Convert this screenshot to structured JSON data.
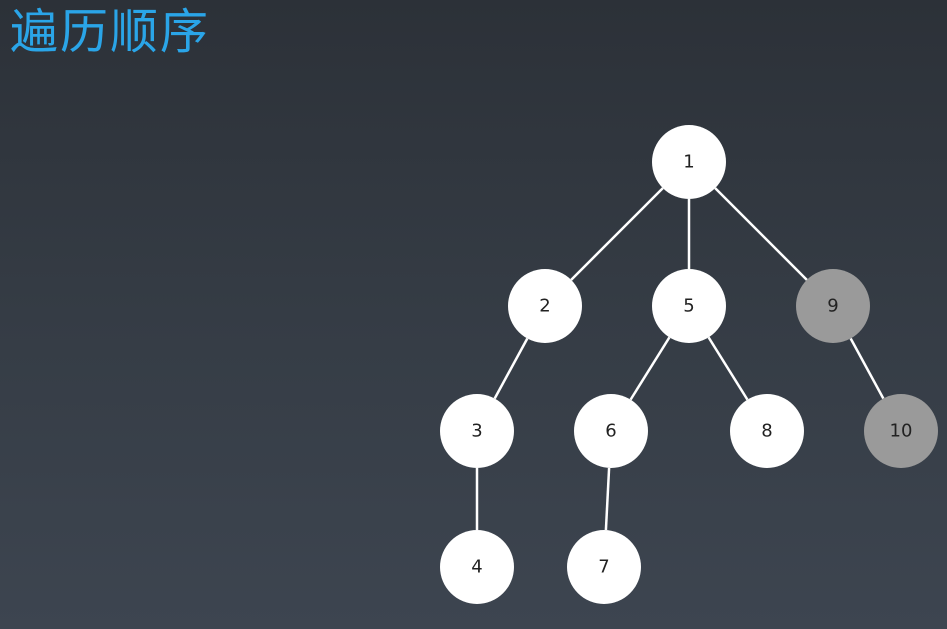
{
  "title": "遍历顺序",
  "colors": {
    "title": "#2aa5e8",
    "node_fill": "#ffffff",
    "node_fill_highlight": "#9a9a9a",
    "edge": "#ffffff",
    "label": "#222222"
  },
  "tree": {
    "nodes": [
      {
        "id": "1",
        "label": "1",
        "highlighted": false
      },
      {
        "id": "2",
        "label": "2",
        "highlighted": false
      },
      {
        "id": "5",
        "label": "5",
        "highlighted": false
      },
      {
        "id": "9",
        "label": "9",
        "highlighted": true
      },
      {
        "id": "3",
        "label": "3",
        "highlighted": false
      },
      {
        "id": "6",
        "label": "6",
        "highlighted": false
      },
      {
        "id": "8",
        "label": "8",
        "highlighted": false
      },
      {
        "id": "10",
        "label": "10",
        "highlighted": true
      },
      {
        "id": "4",
        "label": "4",
        "highlighted": false
      },
      {
        "id": "7",
        "label": "7",
        "highlighted": false
      }
    ],
    "edges": [
      {
        "from": "1",
        "to": "2"
      },
      {
        "from": "1",
        "to": "5"
      },
      {
        "from": "1",
        "to": "9"
      },
      {
        "from": "2",
        "to": "3"
      },
      {
        "from": "5",
        "to": "6"
      },
      {
        "from": "5",
        "to": "8"
      },
      {
        "from": "9",
        "to": "10"
      },
      {
        "from": "3",
        "to": "4"
      },
      {
        "from": "6",
        "to": "7"
      }
    ]
  }
}
